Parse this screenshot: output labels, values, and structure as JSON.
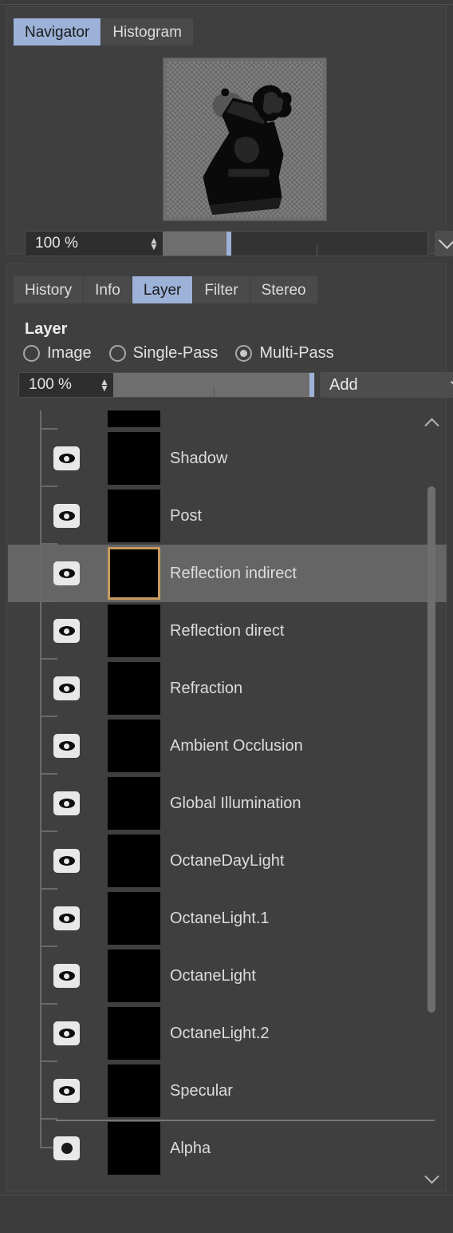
{
  "navigator_panel": {
    "tabs": [
      {
        "label": "Navigator",
        "active": true
      },
      {
        "label": "Histogram",
        "active": false
      }
    ],
    "preview": {
      "name": "render-preview-thumbnail",
      "background": "checkerboard-transparency"
    },
    "zoom": {
      "value": "100 %",
      "slider_fill_percent": 25,
      "handle_percent": 25
    },
    "dropdown_icon": "chevron-down-icon"
  },
  "layer_panel": {
    "tabs": [
      {
        "label": "History",
        "active": false
      },
      {
        "label": "Info",
        "active": false
      },
      {
        "label": "Layer",
        "active": true
      },
      {
        "label": "Filter",
        "active": false
      },
      {
        "label": "Stereo",
        "active": false
      }
    ],
    "heading": "Layer",
    "modes": [
      {
        "label": "Image",
        "selected": false
      },
      {
        "label": "Single-Pass",
        "selected": false
      },
      {
        "label": "Multi-Pass",
        "selected": true
      }
    ],
    "opacity": {
      "value": "100 %",
      "slider_fill_percent": 100,
      "handle_percent": 100
    },
    "add_dropdown": {
      "label": "Add",
      "icon": "chevron-down-icon"
    },
    "rows": [
      {
        "label": "",
        "icon": "eye-icon",
        "visible": true,
        "selected": false,
        "partial": true
      },
      {
        "label": "Shadow",
        "icon": "eye-icon",
        "visible": true,
        "selected": false
      },
      {
        "label": "Post",
        "icon": "eye-icon",
        "visible": true,
        "selected": false
      },
      {
        "label": "Reflection indirect",
        "icon": "eye-icon",
        "visible": true,
        "selected": true
      },
      {
        "label": "Reflection direct",
        "icon": "eye-icon",
        "visible": true,
        "selected": false
      },
      {
        "label": "Refraction",
        "icon": "eye-icon",
        "visible": true,
        "selected": false
      },
      {
        "label": "Ambient Occlusion",
        "icon": "eye-icon",
        "visible": true,
        "selected": false
      },
      {
        "label": "Global Illumination",
        "icon": "eye-icon",
        "visible": true,
        "selected": false
      },
      {
        "label": "OctaneDayLight",
        "icon": "eye-icon",
        "visible": true,
        "selected": false
      },
      {
        "label": "OctaneLight.1",
        "icon": "eye-icon",
        "visible": true,
        "selected": false
      },
      {
        "label": "OctaneLight",
        "icon": "eye-icon",
        "visible": true,
        "selected": false
      },
      {
        "label": "OctaneLight.2",
        "icon": "eye-icon",
        "visible": true,
        "selected": false
      },
      {
        "label": "Specular",
        "icon": "eye-icon",
        "visible": true,
        "selected": false
      },
      {
        "label": "Alpha",
        "icon": "dot-icon",
        "visible": true,
        "selected": false,
        "divider_above": true
      }
    ],
    "scrollbar": {
      "up_icon": "chevron-up-icon",
      "down_icon": "chevron-down-icon",
      "thumb_top_percent": 7,
      "thumb_height_percent": 72
    }
  },
  "colors": {
    "panel_bg": "#3f3f3f",
    "window_bg": "#3c3c3c",
    "tab_bg": "#4a4a4a",
    "tab_active_bg": "#9db2d8",
    "text": "#dcdcdc",
    "selected_row_bg": "#656565",
    "selected_thumb_border": "#c79a5e",
    "slider_handle": "#9db2d8",
    "thumbnail": "#000000"
  }
}
